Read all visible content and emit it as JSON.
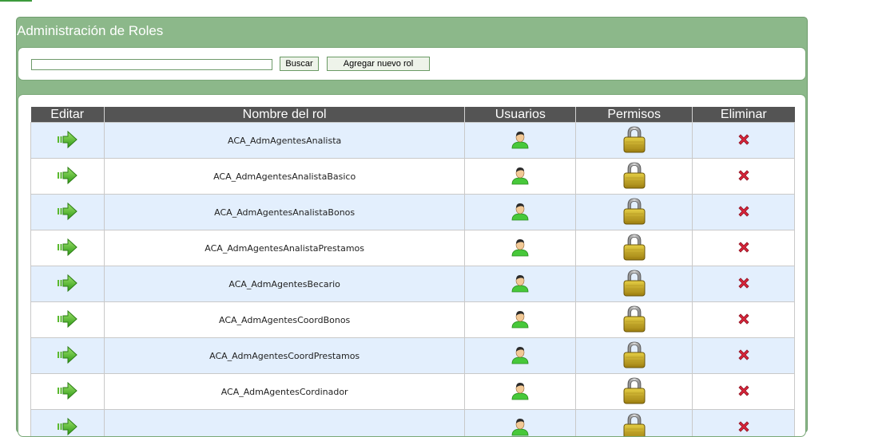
{
  "page": {
    "title": "Administración de Roles"
  },
  "toolbar": {
    "search_value": "",
    "search_label": "Buscar",
    "add_label": "Agregar nuevo rol"
  },
  "table": {
    "headers": {
      "edit": "Editar",
      "name": "Nombre del rol",
      "users": "Usuarios",
      "permissions": "Permisos",
      "delete": "Eliminar"
    },
    "rows": [
      "ACA_AdmAgentesAnalista",
      "ACA_AdmAgentesAnalistaBasico",
      "ACA_AdmAgentesAnalistaBonos",
      "ACA_AdmAgentesAnalistaPrestamos",
      "ACA_AdmAgentesBecario",
      "ACA_AdmAgentesCoordBonos",
      "ACA_AdmAgentesCoordPrestamos",
      "ACA_AdmAgentesCordinador",
      ""
    ]
  },
  "icons": {
    "edit": "arrow-right-icon",
    "users": "user-icon",
    "permissions": "lock-icon",
    "delete": "delete-x-icon"
  },
  "colors": {
    "panel": "#8cb88a",
    "header": "#545454",
    "row_alt": "#e3effd",
    "arrow": "#4fb82a",
    "delete": "#d9253a"
  }
}
